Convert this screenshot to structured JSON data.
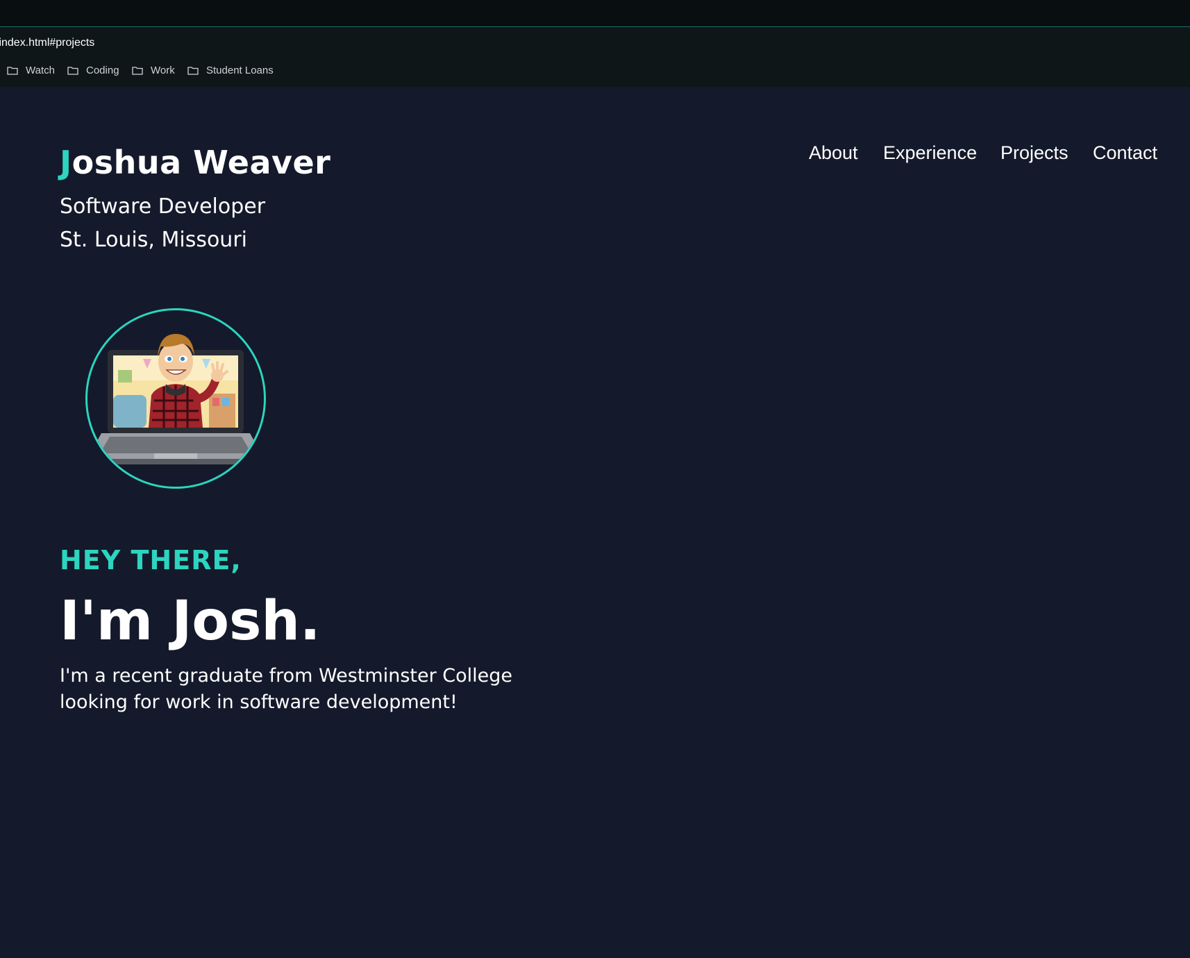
{
  "browser": {
    "url": "/index.html#projects",
    "bookmarks": [
      {
        "label": "Watch",
        "icon": "folder-icon"
      },
      {
        "label": "Coding",
        "icon": "folder-icon"
      },
      {
        "label": "Work",
        "icon": "folder-icon"
      },
      {
        "label": "Student Loans",
        "icon": "folder-icon"
      }
    ]
  },
  "header": {
    "name_first_letter": "J",
    "name_rest": "oshua Weaver",
    "role": "Software Developer",
    "location": "St. Louis, Missouri"
  },
  "nav": {
    "items": [
      "About",
      "Experience",
      "Projects",
      "Contact"
    ]
  },
  "hero": {
    "greeting": "HEY THERE,",
    "headline": "I'm Josh.",
    "intro": "I'm a recent graduate from Westminster College looking for work in software development!"
  },
  "colors": {
    "accent": "#2dd4bf",
    "background": "#141a2b",
    "text": "#ffffff"
  }
}
